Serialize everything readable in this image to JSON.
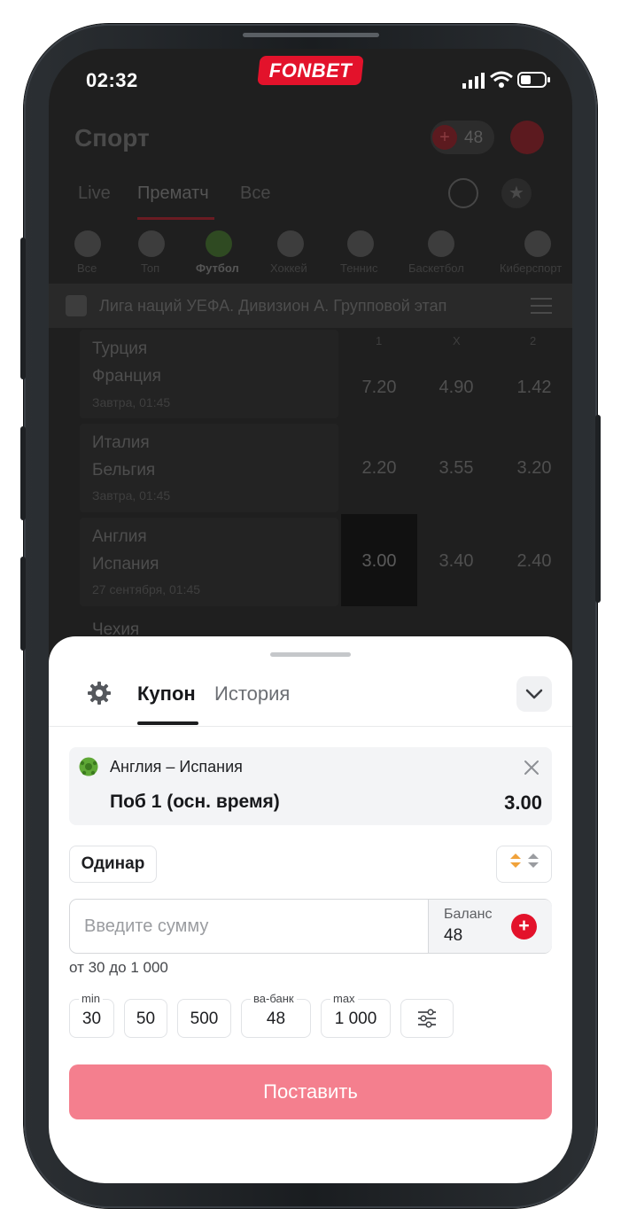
{
  "status_bar": {
    "time": "02:32",
    "brand": "FONBET"
  },
  "header": {
    "title": "Спорт",
    "balance_badge": "48"
  },
  "tabs": [
    "Live",
    "Прематч",
    "Все"
  ],
  "sports": [
    "Все",
    "Топ",
    "Футбол",
    "Хоккей",
    "Теннис",
    "Баскетбол",
    "Киберспорт"
  ],
  "league": "Лига наций УЕФА. Дивизион А. Групповой этап",
  "odds_headers": [
    "1",
    "X",
    "2"
  ],
  "matches": [
    {
      "team1": "Турция",
      "team2": "Франция",
      "date": "Завтра, 01:45",
      "odd1": "7.20",
      "oddx": "4.90",
      "odd2": "1.42"
    },
    {
      "team1": "Италия",
      "team2": "Бельгия",
      "date": "Завтра, 01:45",
      "odd1": "2.20",
      "oddx": "3.55",
      "odd2": "3.20"
    },
    {
      "team1": "Англия",
      "team2": "Испания",
      "date": "27 сентября, 01:45",
      "odd1": "3.00",
      "oddx": "3.40",
      "odd2": "2.40"
    },
    {
      "team1": "Чехия"
    }
  ],
  "coupon": {
    "tab_coupon": "Купон",
    "tab_history": "История",
    "bet": {
      "match": "Англия – Испания",
      "outcome": "Поб 1 (осн. время)",
      "coef": "3.00"
    },
    "bet_type": "Одинар",
    "amount_placeholder": "Введите сумму",
    "balance_label": "Баланс",
    "balance_value": "48",
    "range": "от 30 до 1 000",
    "quick": [
      {
        "label": "min",
        "value": "30"
      },
      {
        "label": "",
        "value": "50"
      },
      {
        "label": "",
        "value": "500"
      },
      {
        "label": "ва-банк",
        "value": "48"
      },
      {
        "label": "max",
        "value": "1 000"
      }
    ],
    "place_button": "Поставить"
  },
  "colors": {
    "brand": "#e3122b",
    "place_button": "#f47f8e"
  }
}
